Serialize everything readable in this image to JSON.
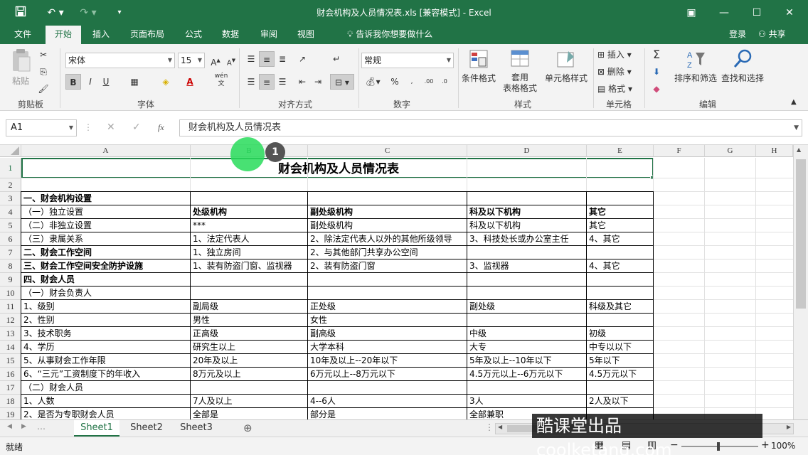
{
  "window": {
    "title": "财会机构及人员情况表.xls  [兼容模式] - Excel",
    "controls": [
      "restore-ribbon",
      "minimize",
      "maximize",
      "close"
    ]
  },
  "ribbon_tabs": [
    "文件",
    "开始",
    "插入",
    "页面布局",
    "公式",
    "数据",
    "审阅",
    "视图"
  ],
  "active_tab": "开始",
  "tell_me": "告诉我你想要做什么",
  "account": {
    "login": "登录",
    "share": "共享"
  },
  "ribbon": {
    "clipboard": {
      "label": "剪贴板",
      "paste": "粘贴"
    },
    "font": {
      "label": "字体",
      "name": "宋体",
      "size": "15",
      "wen": "wén"
    },
    "alignment": {
      "label": "对齐方式"
    },
    "number": {
      "label": "数字",
      "format": "常规",
      "percent": "%"
    },
    "styles": {
      "label": "样式",
      "conditional": "条件格式",
      "table_format_1": "套用",
      "table_format_2": "表格格式",
      "cell_styles": "单元格样式"
    },
    "cells": {
      "label": "单元格",
      "insert": "插入",
      "delete": "删除",
      "format": "格式"
    },
    "editing": {
      "label": "编辑",
      "sort_filter": "排序和筛选",
      "find_select": "查找和选择"
    }
  },
  "formula_bar": {
    "name_box": "A1",
    "content": "财会机构及人员情况表",
    "fx": "fx"
  },
  "column_headers": [
    "A",
    "B",
    "C",
    "D",
    "E",
    "F",
    "G",
    "H"
  ],
  "row_numbers": [
    "1",
    "2",
    "3",
    "4",
    "5",
    "6",
    "7",
    "8",
    "9",
    "10",
    "11",
    "12",
    "13",
    "14",
    "15",
    "16",
    "17",
    "18",
    "19"
  ],
  "sheet_title": "财会机构及人员情况表",
  "rows": [
    {
      "r": "3",
      "a": "一、财会机构设置",
      "b": "",
      "c": "",
      "d": "",
      "e": "",
      "bold": true
    },
    {
      "r": "4",
      "a": "（一）独立设置",
      "b": "处级机构",
      "c": "副处级机构",
      "d": "科及以下机构",
      "e": "其它",
      "boldbcde": true
    },
    {
      "r": "5",
      "a": "（二）非独立设置",
      "b": "***",
      "c": "副处级机构",
      "d": "科及以下机构",
      "e": "其它"
    },
    {
      "r": "6",
      "a": "（三）隶属关系",
      "b": "1、法定代表人",
      "c": "2、除法定代表人以外的其他所级领导",
      "d": "3、科技处长或办公室主任",
      "e": "4、其它"
    },
    {
      "r": "7",
      "a": "二、财会工作空间",
      "b": "1、独立房间",
      "c": "2、与其他部门共享办公空间",
      "d": "",
      "e": "",
      "bold": true
    },
    {
      "r": "8",
      "a": "三、财会工作空间安全防护设施",
      "b": "1、装有防盗门窗、监视器",
      "c": "2、装有防盗门窗",
      "d": "3、监视器",
      "e": "4、其它",
      "bold": true
    },
    {
      "r": "9",
      "a": "四、财会人员",
      "b": "",
      "c": "",
      "d": "",
      "e": "",
      "bold": true
    },
    {
      "r": "10",
      "a": "（一）财会负责人",
      "b": "",
      "c": "",
      "d": "",
      "e": ""
    },
    {
      "r": "11",
      "a": "1、级别",
      "b": "副局级",
      "c": "正处级",
      "d": "副处级",
      "e": "科级及其它"
    },
    {
      "r": "12",
      "a": "2、性别",
      "b": "男性",
      "c": "女性",
      "d": "",
      "e": ""
    },
    {
      "r": "13",
      "a": "3、技术职务",
      "b": "正高级",
      "c": "副高级",
      "d": "中级",
      "e": "初级"
    },
    {
      "r": "14",
      "a": "4、学历",
      "b": "研究生以上",
      "c": "大学本科",
      "d": "大专",
      "e": "中专以以下"
    },
    {
      "r": "15",
      "a": "5、从事财会工作年限",
      "b": "20年及以上",
      "c": "10年及以上--20年以下",
      "d": "5年及以上--10年以下",
      "e": "5年以下"
    },
    {
      "r": "16",
      "a": "6、“三元”工资制度下的年收入",
      "b": "8万元及以上",
      "c": "6万元以上--8万元以下",
      "d": "4.5万元以上--6万元以下",
      "e": "4.5万元以下"
    },
    {
      "r": "17",
      "a": "（二）财会人员",
      "b": "",
      "c": "",
      "d": "",
      "e": ""
    },
    {
      "r": "18",
      "a": "1、人数",
      "b": "7人及以上",
      "c": "4--6人",
      "d": "3人",
      "e": "2人及以下"
    },
    {
      "r": "19",
      "a": "2、是否为专职财会人员",
      "b": "全部是",
      "c": "部分是",
      "d": "全部兼职",
      "e": ""
    }
  ],
  "sheets": [
    "Sheet1",
    "Sheet2",
    "Sheet3"
  ],
  "active_sheet": "Sheet1",
  "status": {
    "ready": "就绪",
    "zoom": "100%"
  },
  "overlay": {
    "step_badge": "1",
    "watermark": "酷课堂出品 coolketang.com"
  },
  "colors": {
    "excel_green": "#217346",
    "ribbon_bg": "#f3f3f3",
    "highlight_dot": "#28dc5a"
  }
}
